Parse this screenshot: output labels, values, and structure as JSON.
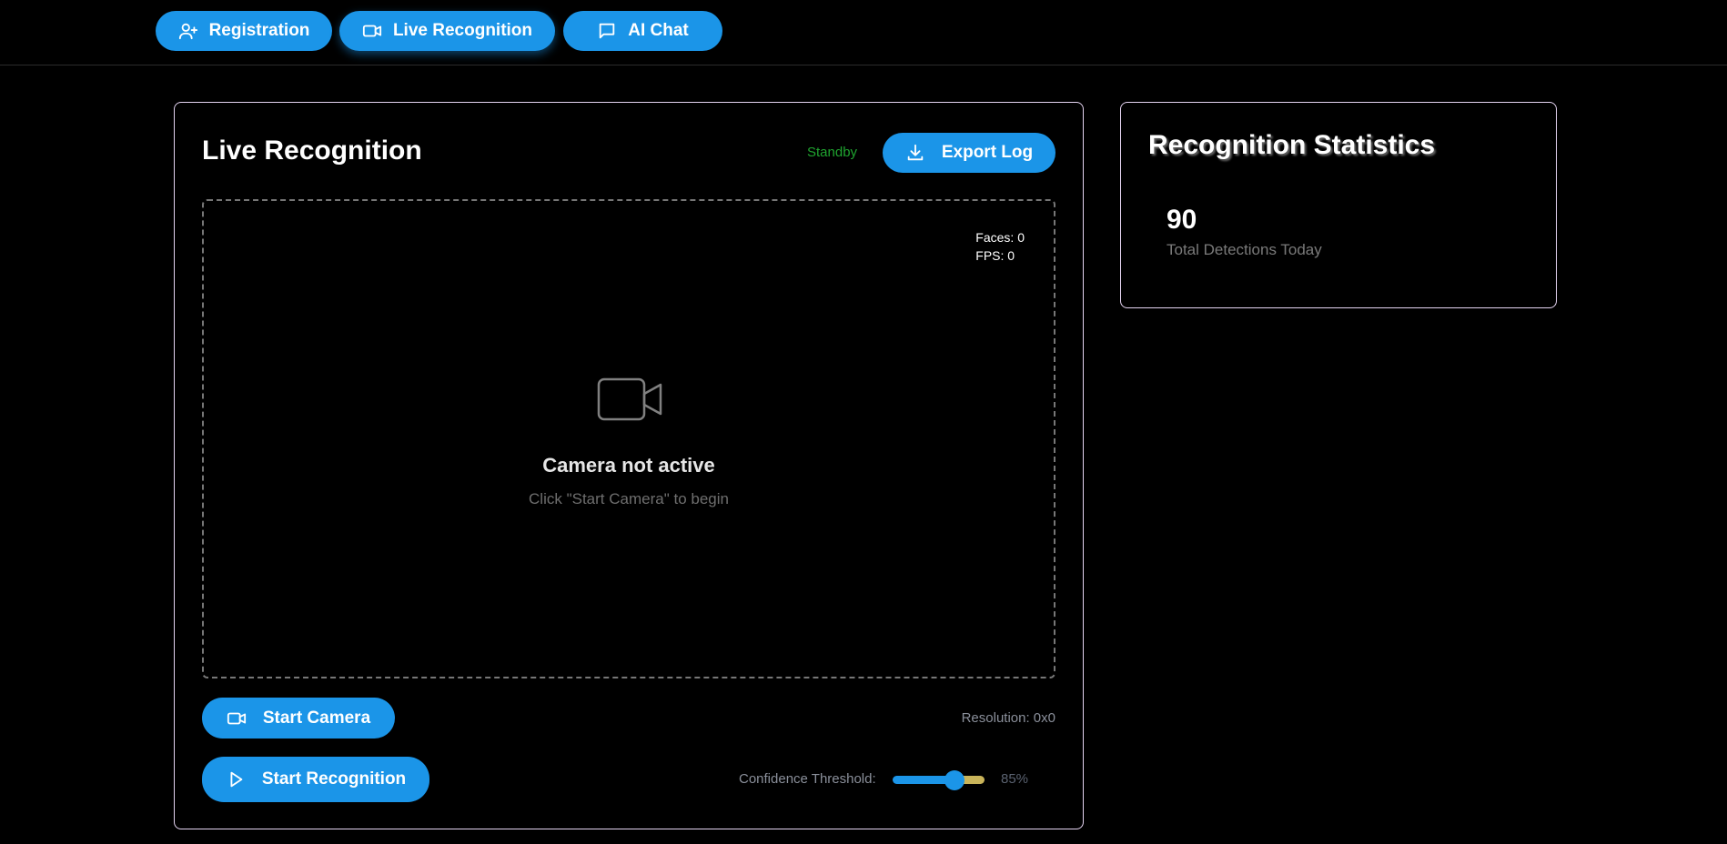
{
  "nav": {
    "tabs": [
      {
        "label": "Registration",
        "icon": "user-plus-icon"
      },
      {
        "label": "Live Recognition",
        "icon": "video-icon"
      },
      {
        "label": "AI Chat",
        "icon": "message-icon"
      }
    ]
  },
  "main": {
    "title": "Live Recognition",
    "status": "Standby",
    "export_label": "Export Log",
    "overlay": {
      "faces": "Faces: 0",
      "fps": "FPS: 0"
    },
    "camera_title": "Camera not active",
    "camera_hint": "Click \"Start Camera\" to begin",
    "start_camera_label": "Start Camera",
    "start_recognition_label": "Start Recognition",
    "resolution": "Resolution: 0x0",
    "confidence_label": "Confidence Threshold:",
    "confidence_value": "85%",
    "confidence_fraction": 0.67
  },
  "stats": {
    "title": "Recognition Statistics",
    "total_value": "90",
    "total_label": "Total Detections Today"
  },
  "colors": {
    "accent": "#1b95e8",
    "status_ok": "#1fa32f",
    "card_border": "#e5d4f2"
  }
}
